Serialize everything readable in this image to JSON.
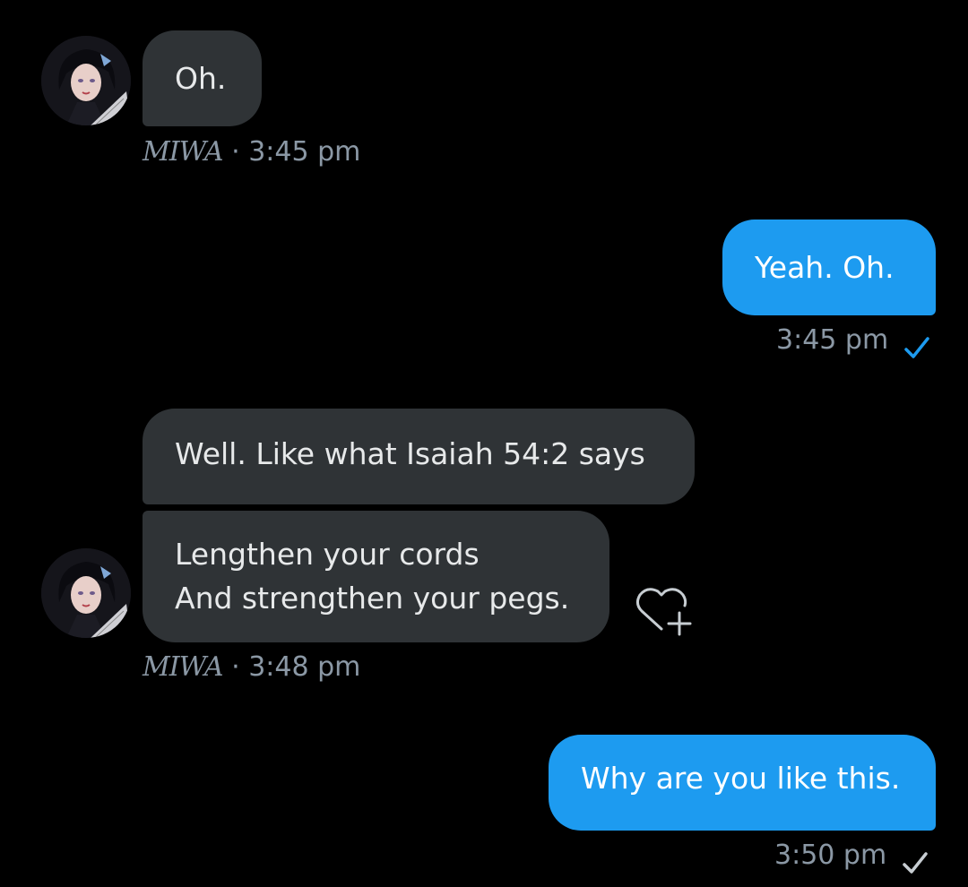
{
  "messages": [
    {
      "text": "Oh.",
      "sender": "MIWA",
      "separator": "·",
      "time": "3:45 pm"
    },
    {
      "text": "Yeah. Oh.",
      "time": "3:45 pm",
      "status": "seen",
      "status_color": "#1d9bf0"
    },
    {
      "text": "Well. Like what Isaiah 54:2 says"
    },
    {
      "text": "Lengthen your cords\nAnd strengthen your pegs.",
      "sender": "MIWA",
      "separator": "·",
      "time": "3:48 pm"
    },
    {
      "text": "Why are you like this.",
      "time": "3:50 pm",
      "status": "sent",
      "status_color": "#8b98a5"
    }
  ],
  "icons": {
    "avatar": "profile-avatar",
    "reaction": "heart-plus-icon",
    "read_receipt": "checkmark-icon"
  },
  "colors": {
    "incoming_bubble": "#2f3336",
    "outgoing_bubble": "#1d9bf0",
    "meta_text": "#8b98a5",
    "background": "#000000"
  }
}
